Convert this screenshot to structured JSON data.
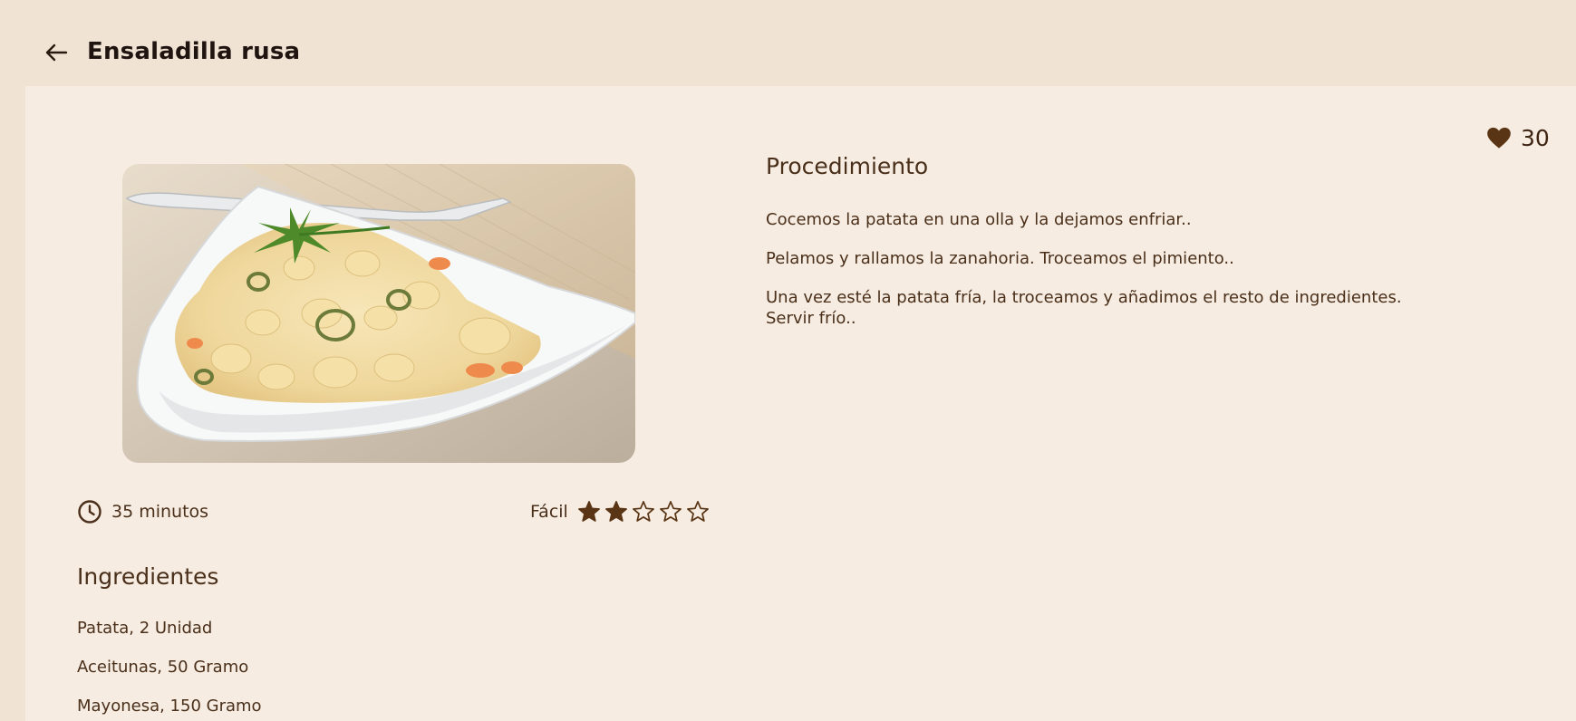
{
  "header": {
    "title": "Ensaladilla rusa",
    "back_icon": "arrow-left-icon"
  },
  "likes": {
    "count": "30",
    "icon": "heart-icon"
  },
  "recipe": {
    "image_alt": "Ensaladilla rusa",
    "time": "35 minutos",
    "time_icon": "clock-icon",
    "difficulty_label": "Fácil",
    "difficulty_rating": 2,
    "difficulty_max": 5
  },
  "ingredients": {
    "title": "Ingredientes",
    "items": [
      "Patata,  2 Unidad",
      "Aceitunas,  50 Gramo",
      "Mayonesa,  150 Gramo"
    ]
  },
  "procedure": {
    "title": "Procedimiento",
    "steps": [
      "Cocemos la patata en una olla y la dejamos enfriar..",
      "Pelamos y rallamos la zanahoria. Troceamos el pimiento..",
      "Una vez esté la patata fría, la troceamos y añadimos el resto de ingredientes. Servir frío.."
    ]
  },
  "colors": {
    "background": "#f0e3d4",
    "panel": "#f6ece1",
    "accent": "#5a3515",
    "text": "#4a2f1a"
  }
}
